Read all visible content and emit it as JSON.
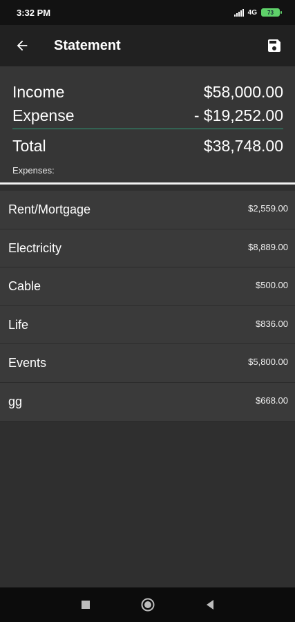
{
  "status_bar": {
    "time": "3:32 PM",
    "network": "4G",
    "battery": "73"
  },
  "app_bar": {
    "title": "Statement",
    "back_icon": "arrow-left-icon",
    "save_icon": "save-floppy-icon"
  },
  "summary": {
    "income_label": "Income",
    "income_value": "$58,000.00",
    "expense_label": "Expense",
    "expense_value": "- $19,252.00",
    "total_label": "Total",
    "total_value": "$38,748.00",
    "section_label": "Expenses:"
  },
  "expenses": [
    {
      "name": "Rent/Mortgage",
      "amount": "$2,559.00"
    },
    {
      "name": "Electricity",
      "amount": "$8,889.00"
    },
    {
      "name": "Cable",
      "amount": "$500.00"
    },
    {
      "name": "Life",
      "amount": "$836.00"
    },
    {
      "name": "Events",
      "amount": "$5,800.00"
    },
    {
      "name": "gg",
      "amount": "$668.00"
    }
  ],
  "nav_bar": {
    "recents_icon": "square-icon",
    "home_icon": "circle-icon",
    "back_icon": "triangle-back-icon"
  },
  "colors": {
    "accent_divider": "#2f9e78",
    "battery": "#5fd16a",
    "background": "#2f2f2f"
  }
}
